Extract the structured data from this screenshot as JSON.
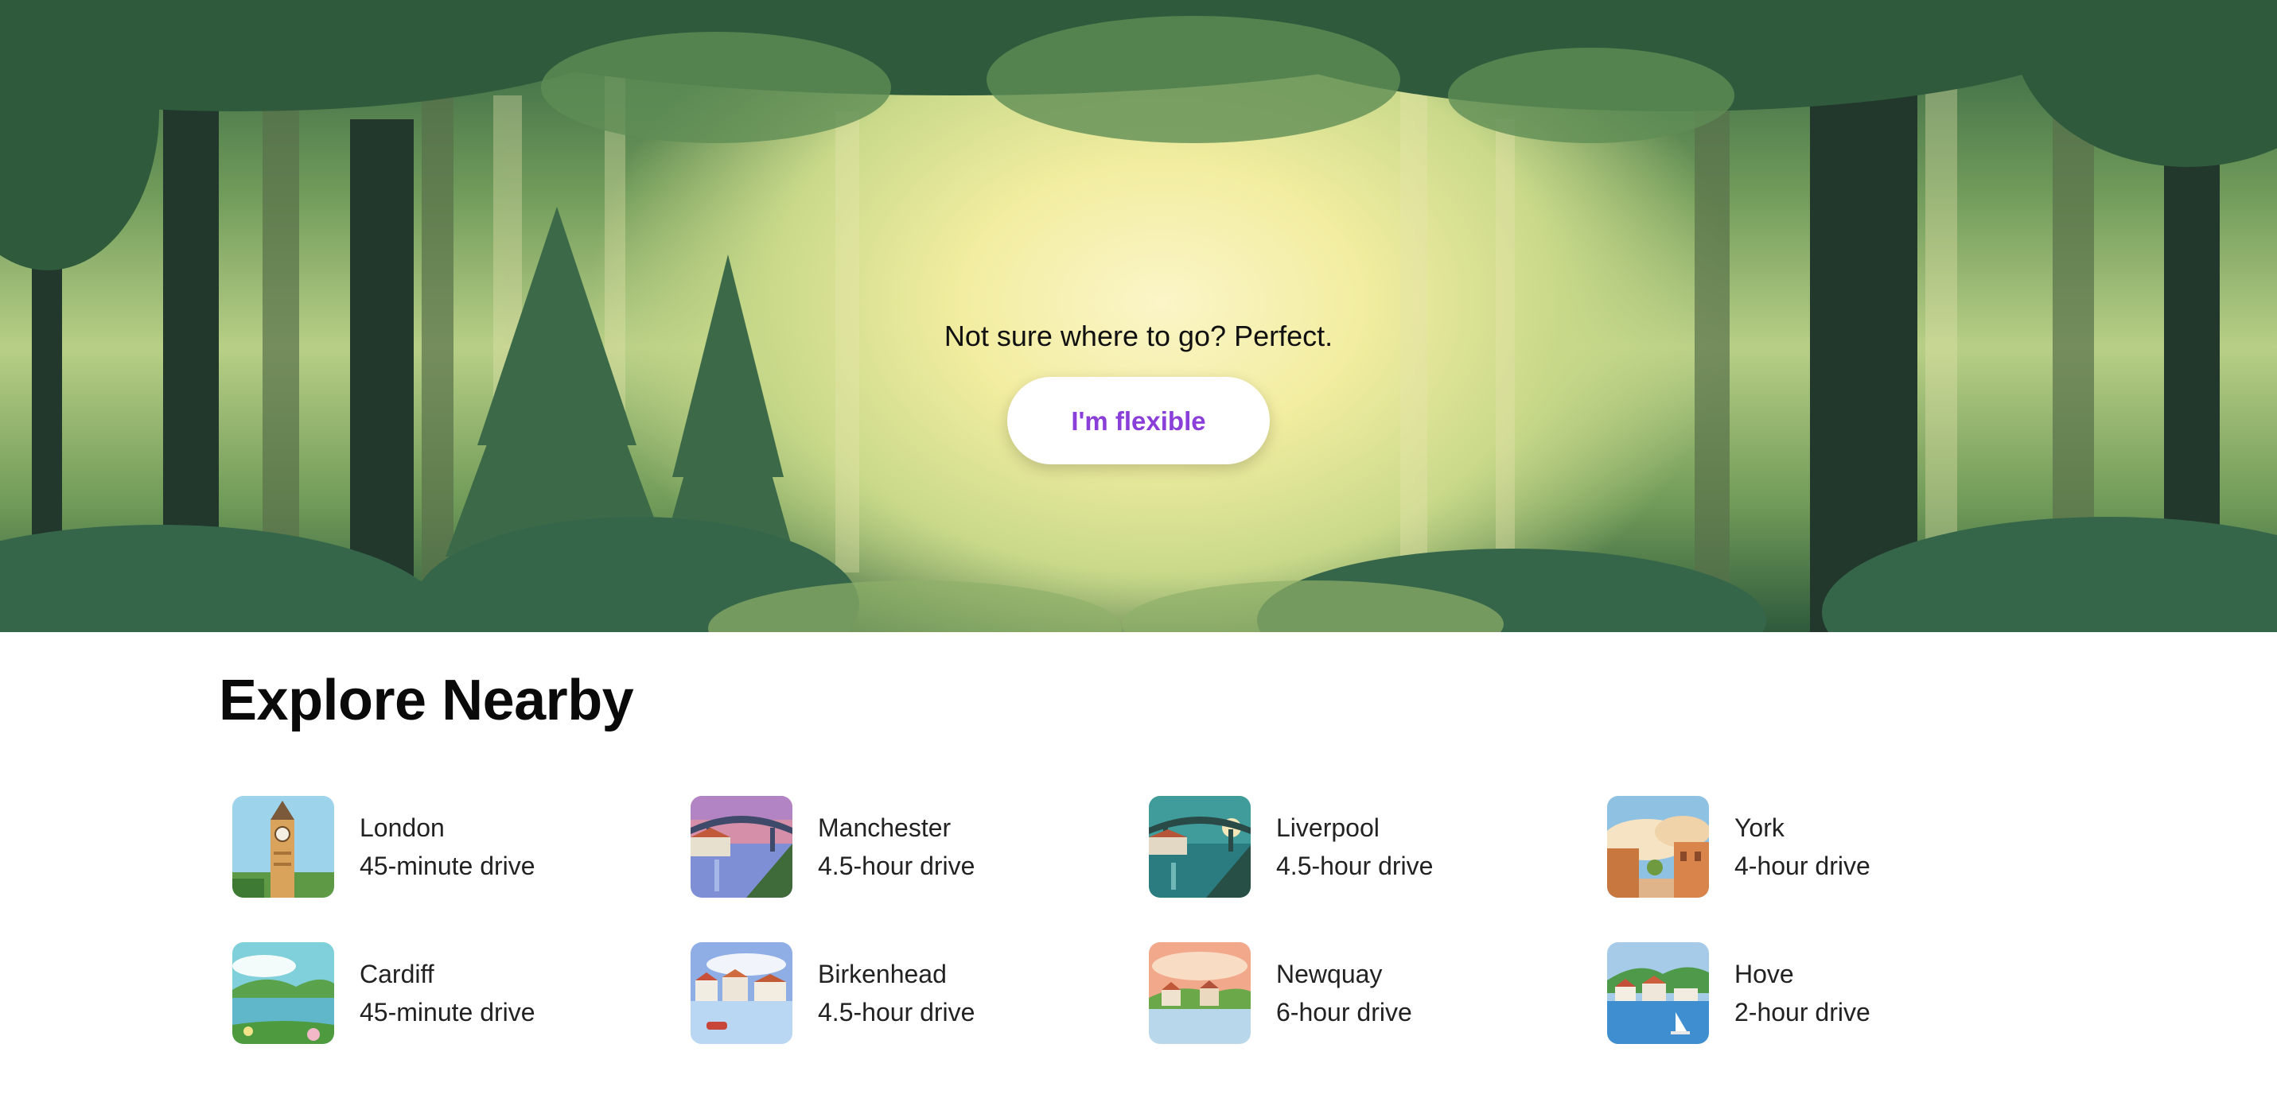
{
  "hero": {
    "tagline": "Not sure where to go? Perfect.",
    "button_label": "I'm flexible",
    "button_color": "#8a3fd9"
  },
  "explore": {
    "title": "Explore Nearby",
    "destinations": [
      {
        "city": "London",
        "drive": "45-minute drive",
        "image": "big-ben-illustration"
      },
      {
        "city": "Manchester",
        "drive": "4.5-hour drive",
        "image": "bridge-river-illustration"
      },
      {
        "city": "Liverpool",
        "drive": "4.5-hour drive",
        "image": "bridge-teal-river-illustration"
      },
      {
        "city": "York",
        "drive": "4-hour drive",
        "image": "old-town-illustration"
      },
      {
        "city": "Cardiff",
        "drive": "45-minute drive",
        "image": "lake-hills-illustration"
      },
      {
        "city": "Birkenhead",
        "drive": "4.5-hour drive",
        "image": "harbour-houses-illustration"
      },
      {
        "city": "Newquay",
        "drive": "6-hour drive",
        "image": "coastal-village-illustration"
      },
      {
        "city": "Hove",
        "drive": "2-hour drive",
        "image": "seaside-sailboat-illustration"
      }
    ]
  }
}
